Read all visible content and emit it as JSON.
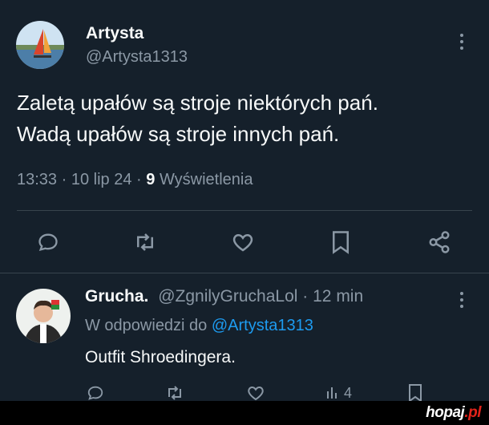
{
  "tweet": {
    "display_name": "Artysta",
    "handle": "@Artysta1313",
    "text_line1": "Zaletą upałów są stroje niektórych pań.",
    "text_line2": "Wadą upałów są stroje innych pań.",
    "time": "13:33",
    "sep1": "·",
    "date": "10 lip 24",
    "sep2": "·",
    "views_count": "9",
    "views_label": "Wyświetlenia",
    "actions": [
      "reply-icon",
      "retweet-icon",
      "like-icon",
      "bookmark-icon",
      "share-icon"
    ]
  },
  "reply": {
    "display_name": "Grucha.",
    "handle": "@ZgnilyGruchaLol",
    "sep": "·",
    "time_ago": "12 min",
    "replying_prefix": "W odpowiedzi do",
    "replying_to": "@Artysta1313",
    "text": "Outfit Shroedingera.",
    "views_count": "4"
  },
  "watermark": {
    "brand": "hopaj",
    "suffix": ".pl"
  },
  "colors": {
    "background": "#15202b",
    "text": "#f7f9f9",
    "muted": "#8b98a5",
    "accent": "#1d9bf0",
    "divider": "#38444d"
  }
}
